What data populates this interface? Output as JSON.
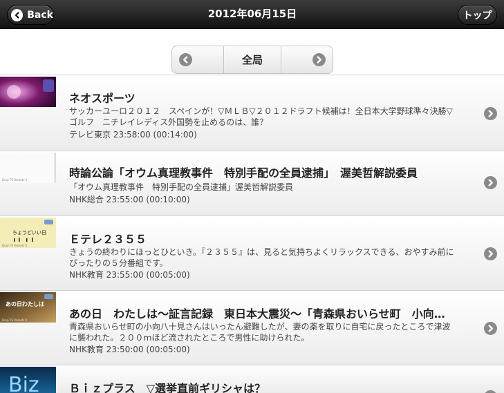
{
  "header": {
    "title": "2012年06月15日",
    "back_label": "Back",
    "top_label": "トップ"
  },
  "segment": {
    "label": "全局"
  },
  "programs": [
    {
      "title": "ネオスポーツ",
      "description": "サッカーユーロ２０１２　スペインが！▽ＭＬＢ▽２０１２ドラフト候補は！全日本大学野球準々決勝▽ゴルフ　ニチレイレディス外国勢を止めるのは、誰？",
      "channel_time": "テレビ東京 23:58:00 (00:14:00)"
    },
    {
      "title": "時論公論「オウム真理教事件　特別手配の全員逮捕」　渥美哲解説委員",
      "description": "「オウム真理教事件　特別手配の全員逮捕」渥美哲解説委員",
      "channel_time": "NHK総合 23:55:00 (00:10:00)"
    },
    {
      "title": "Ｅテレ２３５５",
      "description": "きょうの終わりにほっとひといき。『２３５５』は、見ると気持ちよくリラックスできる、おやすみ前にぴったりの５分番組です。",
      "channel_time": "NHK教育 23:55:00 (00:05:00)"
    },
    {
      "title": "あの日　わたしは～証言記録　東日本大震災～「青森県おいらせ町　小向八十見さん」",
      "description": "青森県おいらせ町の小向八十見さんはいったん避難したが、妻の薬を取りに自宅に戻ったところで津波に襲われた。２００ｍほど流されたところで男性に助けられた。",
      "channel_time": "NHK教育 23:50:00 (00:05:00)"
    },
    {
      "title": "Ｂｉｚプラス　▽選挙直前ギリシャは？",
      "description": "",
      "channel_time": ""
    }
  ],
  "thumbnails": {
    "sports": {
      "caption": ""
    },
    "jiron": {
      "caption": "Drop TS Packets 0"
    },
    "etele": {
      "caption": "Drop TS Packets 0",
      "art_text": "ちょうどいい日"
    },
    "anohi": {
      "caption": "Drop TS Packets 0",
      "art_text": "あの日わたしは"
    },
    "biz": {
      "art_text": "Biz"
    }
  },
  "colors": {
    "header_bg": "#1f1f1f",
    "icon_gray": "#8a8a8a"
  }
}
